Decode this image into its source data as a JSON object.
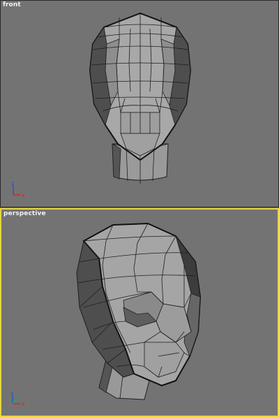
{
  "viewports": {
    "front": {
      "label": "front"
    },
    "perspective": {
      "label": "perspective"
    }
  },
  "axes": {
    "x": "x",
    "y": "y",
    "z": "z"
  },
  "colors": {
    "viewport_bg": "#737373",
    "active_border": "#e5d63a",
    "mesh_light": "#a8a8a8",
    "mesh_mid": "#8e8e8e",
    "mesh_dark": "#4e4e4e",
    "edge": "#1e1e1e",
    "axis_x": "#d22a2a",
    "axis_y": "#2fa84a",
    "axis_z": "#2a52d8"
  }
}
